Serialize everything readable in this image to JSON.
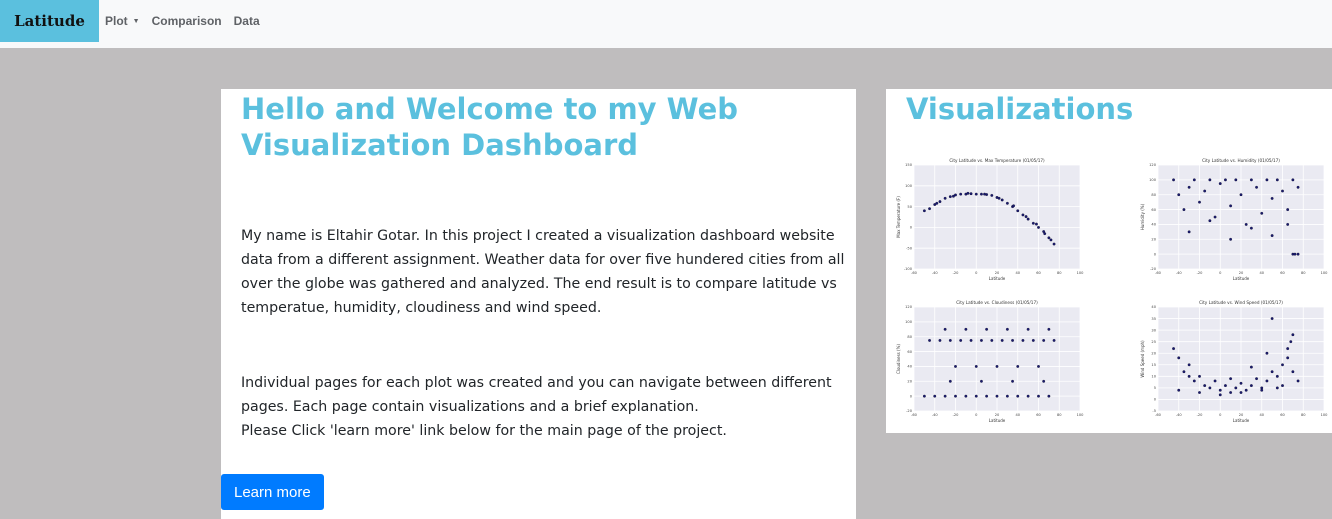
{
  "navbar": {
    "brand": "Latitude",
    "links": [
      "Plot",
      "Comparison",
      "Data"
    ]
  },
  "welcome": {
    "title": "Hello and Welcome to my Web Visualization Dashboard",
    "paragraph1": "My name is Eltahir Gotar. In this project I created a visualization dashboard website data from a different assignment. Weather data for over five hundered cities from all over the globe was gathered and analyzed. The end result is to compare latitude vs temperatue, humidity, cloudiness and wind speed.",
    "paragraph2_line1": "Individual pages for each plot was created and you can navigate between different pages. Each page contain visualizations and a brief explanation.",
    "paragraph2_line2": "Please Click 'learn more' link below for the main page of the project.",
    "button": "Learn more"
  },
  "visualizations": {
    "title": "Visualizations"
  },
  "colors": {
    "accent": "#5bc0de",
    "button": "#007bff",
    "background": "#bfbdbe",
    "marker": "#1a1a6e"
  },
  "chart_data": [
    {
      "type": "scatter",
      "title": "City Latitude vs. Max Temperature (01/05/17)",
      "xlabel": "Latitude",
      "ylabel": "Max Temperature (F)",
      "xlim": [
        -60,
        100
      ],
      "ylim": [
        -100,
        150
      ],
      "xticks": [
        -60,
        -40,
        -20,
        0,
        20,
        40,
        60,
        80,
        100
      ],
      "yticks": [
        -100,
        -50,
        0,
        50,
        100,
        150
      ],
      "grid": true,
      "x": [
        -50,
        -45,
        -40,
        -35,
        -30,
        -25,
        -20,
        -15,
        -10,
        -5,
        0,
        5,
        10,
        15,
        20,
        25,
        30,
        35,
        40,
        45,
        50,
        55,
        60,
        65,
        70,
        75,
        -38,
        -22,
        -8,
        8,
        22,
        36,
        48,
        58,
        66,
        72
      ],
      "y": [
        40,
        45,
        55,
        62,
        70,
        74,
        78,
        80,
        80,
        81,
        80,
        80,
        79,
        77,
        72,
        66,
        58,
        50,
        40,
        30,
        20,
        10,
        0,
        -10,
        -25,
        -40,
        58,
        75,
        82,
        80,
        70,
        52,
        26,
        8,
        -15,
        -30
      ]
    },
    {
      "type": "scatter",
      "title": "City Latitude vs. Humidity (01/05/17)",
      "xlabel": "Latitude",
      "ylabel": "Humidity (%)",
      "xlim": [
        -60,
        100
      ],
      "ylim": [
        -20,
        120
      ],
      "xticks": [
        -60,
        -40,
        -20,
        0,
        20,
        40,
        60,
        80,
        100
      ],
      "yticks": [
        -20,
        0,
        20,
        40,
        60,
        80,
        100,
        120
      ],
      "grid": true,
      "x": [
        -45,
        -40,
        -35,
        -30,
        -25,
        -20,
        -15,
        -10,
        -5,
        0,
        5,
        10,
        15,
        20,
        25,
        30,
        35,
        40,
        45,
        50,
        55,
        60,
        65,
        70,
        75,
        -30,
        -10,
        10,
        30,
        50,
        65,
        70,
        72,
        75
      ],
      "y": [
        100,
        80,
        60,
        90,
        100,
        70,
        85,
        100,
        50,
        95,
        100,
        65,
        100,
        80,
        40,
        100,
        90,
        55,
        100,
        75,
        100,
        85,
        60,
        100,
        90,
        30,
        45,
        20,
        35,
        25,
        40,
        0,
        0,
        0
      ]
    },
    {
      "type": "scatter",
      "title": "City Latitude vs. Cloudiness (01/05/17)",
      "xlabel": "Latitude",
      "ylabel": "Cloudiness (%)",
      "xlim": [
        -60,
        100
      ],
      "ylim": [
        -20,
        120
      ],
      "xticks": [
        -60,
        -40,
        -20,
        0,
        20,
        40,
        60,
        80,
        100
      ],
      "yticks": [
        -20,
        0,
        20,
        40,
        60,
        80,
        100,
        120
      ],
      "grid": true,
      "x": [
        -50,
        -40,
        -30,
        -20,
        -10,
        0,
        10,
        20,
        30,
        40,
        50,
        60,
        70,
        -45,
        -35,
        -25,
        -15,
        -5,
        5,
        15,
        25,
        35,
        45,
        55,
        65,
        75,
        -30,
        -10,
        10,
        30,
        50,
        70,
        -20,
        0,
        20,
        40,
        60,
        -25,
        5,
        35,
        65
      ],
      "y": [
        0,
        0,
        0,
        0,
        0,
        0,
        0,
        0,
        0,
        0,
        0,
        0,
        0,
        75,
        75,
        75,
        75,
        75,
        75,
        75,
        75,
        75,
        75,
        75,
        75,
        75,
        90,
        90,
        90,
        90,
        90,
        90,
        40,
        40,
        40,
        40,
        40,
        20,
        20,
        20,
        20
      ]
    },
    {
      "type": "scatter",
      "title": "City Latitude vs. Wind Speed (01/05/17)",
      "xlabel": "Latitude",
      "ylabel": "Wind Speed (mph)",
      "xlim": [
        -60,
        100
      ],
      "ylim": [
        -5,
        40
      ],
      "xticks": [
        -60,
        -40,
        -20,
        0,
        20,
        40,
        60,
        80,
        100
      ],
      "yticks": [
        -5,
        0,
        5,
        10,
        15,
        20,
        25,
        30,
        35,
        40
      ],
      "grid": true,
      "x": [
        -45,
        -40,
        -35,
        -30,
        -25,
        -20,
        -15,
        -10,
        -5,
        0,
        5,
        10,
        15,
        20,
        25,
        30,
        35,
        40,
        45,
        50,
        55,
        60,
        65,
        70,
        75,
        -40,
        -20,
        0,
        20,
        40,
        55,
        60,
        65,
        70,
        50,
        30,
        -30,
        10,
        45,
        68
      ],
      "y": [
        22,
        18,
        12,
        15,
        8,
        10,
        6,
        5,
        8,
        4,
        6,
        3,
        5,
        7,
        4,
        6,
        9,
        5,
        8,
        12,
        10,
        15,
        18,
        12,
        8,
        4,
        3,
        2,
        3,
        4,
        5,
        6,
        22,
        28,
        35,
        14,
        10,
        9,
        20,
        25
      ]
    }
  ]
}
